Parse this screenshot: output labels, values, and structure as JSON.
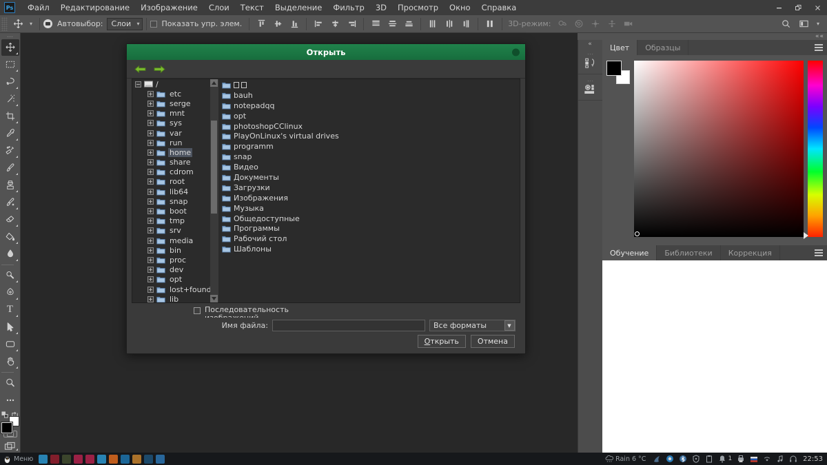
{
  "app": {
    "logo": "Ps",
    "menus": [
      "Файл",
      "Редактирование",
      "Изображение",
      "Слои",
      "Текст",
      "Выделение",
      "Фильтр",
      "3D",
      "Просмотр",
      "Окно",
      "Справка"
    ],
    "window_controls": [
      {
        "name": "minimize-button",
        "glyph": "—"
      },
      {
        "name": "restore-button",
        "glyph": "❐"
      },
      {
        "name": "close-button",
        "glyph": "✕"
      }
    ]
  },
  "options_bar": {
    "tool_icon": "move-tool-icon",
    "autoselect_label": "Автовыбор:",
    "autoselect_value": "Слои",
    "show_controls_label": "Показать упр. элем.",
    "mode3d_label": "3D-режим:",
    "align_icons": [
      "align-top-edges-icon",
      "align-vertical-centers-icon",
      "align-bottom-edges-icon",
      "align-left-edges-icon",
      "align-horizontal-centers-icon",
      "align-right-edges-icon"
    ],
    "distribute_icons": [
      "distribute-top-edges-icon",
      "distribute-vertical-centers-icon",
      "distribute-bottom-edges-icon",
      "distribute-left-edges-icon",
      "distribute-horizontal-centers-icon",
      "distribute-right-edges-icon"
    ],
    "distribute_spacing_icon": "distribute-spacing-icon",
    "mode3d_icons": [
      "orbit-3d-icon",
      "roll-3d-icon",
      "pan-3d-icon",
      "slide-3d-icon",
      "camera-3d-icon"
    ],
    "right_icons": [
      "search-icon",
      "workspace-icon",
      "chevron-down-icon"
    ]
  },
  "toolbar": {
    "tools": [
      {
        "name": "move-tool",
        "icon": "move-icon",
        "active": true,
        "more": true
      },
      {
        "name": "marquee-tool",
        "icon": "rectangular-marquee-icon",
        "more": true
      },
      {
        "name": "lasso-tool",
        "icon": "lasso-icon",
        "more": true
      },
      {
        "name": "magic-wand-tool",
        "icon": "magic-wand-icon",
        "more": true
      },
      {
        "name": "crop-tool",
        "icon": "crop-icon",
        "more": true
      },
      {
        "name": "eyedropper-tool",
        "icon": "eyedropper-icon",
        "more": true
      },
      {
        "name": "healing-brush-tool",
        "icon": "healing-brush-icon",
        "more": true
      },
      {
        "name": "brush-tool",
        "icon": "brush-icon",
        "more": true
      },
      {
        "name": "clone-stamp-tool",
        "icon": "clone-stamp-icon",
        "more": true
      },
      {
        "name": "history-brush-tool",
        "icon": "history-brush-icon",
        "more": true
      },
      {
        "name": "eraser-tool",
        "icon": "eraser-icon",
        "more": true
      },
      {
        "name": "gradient-tool",
        "icon": "paint-bucket-icon",
        "more": true
      },
      {
        "name": "blur-tool",
        "icon": "blur-drop-icon",
        "more": true
      },
      {
        "name": "dodge-tool",
        "icon": "dodge-icon",
        "more": true
      },
      {
        "name": "pen-tool",
        "icon": "pen-icon",
        "more": true
      },
      {
        "name": "type-tool",
        "icon": "type-icon",
        "more": true
      },
      {
        "name": "path-selection-tool",
        "icon": "path-arrow-icon",
        "more": true
      },
      {
        "name": "shape-tool",
        "icon": "rounded-rectangle-icon",
        "more": true
      },
      {
        "name": "hand-tool",
        "icon": "hand-icon",
        "more": true
      },
      {
        "name": "zoom-tool",
        "icon": "magnifier-icon",
        "more": false
      },
      {
        "name": "edit-toolbar",
        "icon": "ellipsis-icon",
        "more": false
      }
    ],
    "swap_colors_icon": "swap-colors-icon",
    "default_colors_icon": "default-colors-icon",
    "foreground_color": "#000000",
    "background_color": "#ffffff",
    "quick_mask_icon": "quick-mask-icon",
    "screen_mode_icon": "screen-mode-icon"
  },
  "dock_rail": {
    "buttons": [
      "history-panel-icon",
      "properties-panel-icon"
    ],
    "collapse_glyph": "«"
  },
  "color_panel": {
    "tabs": [
      {
        "label": "Цвет",
        "active": true
      },
      {
        "label": "Образцы",
        "active": false
      }
    ],
    "menu_icon": "panel-menu-icon",
    "foreground": "#000000",
    "background": "#ffffff",
    "hue_base": "#ff0000"
  },
  "learn_panel": {
    "tabs": [
      {
        "label": "Обучение",
        "active": true
      },
      {
        "label": "Библиотеки",
        "active": false
      },
      {
        "label": "Коррекция",
        "active": false
      }
    ],
    "menu_icon": "panel-menu-icon"
  },
  "dialog": {
    "title": "Открыть",
    "close_icon": "close-dot-icon",
    "back_icon": "back-arrow-icon",
    "forward_icon": "forward-arrow-icon",
    "tree_root": "/",
    "tree_items": [
      {
        "label": "etc"
      },
      {
        "label": "serge"
      },
      {
        "label": "mnt"
      },
      {
        "label": "sys"
      },
      {
        "label": "var"
      },
      {
        "label": "run"
      },
      {
        "label": "home",
        "selected": true
      },
      {
        "label": "share"
      },
      {
        "label": "cdrom"
      },
      {
        "label": "root"
      },
      {
        "label": "lib64"
      },
      {
        "label": "snap"
      },
      {
        "label": "boot"
      },
      {
        "label": "tmp"
      },
      {
        "label": "srv"
      },
      {
        "label": "media"
      },
      {
        "label": "bin"
      },
      {
        "label": "proc"
      },
      {
        "label": "dev"
      },
      {
        "label": "opt"
      },
      {
        "label": "lost+found"
      },
      {
        "label": "lib"
      }
    ],
    "expander_collapsed": "+",
    "expander_expanded": "−",
    "file_items": [
      {
        "label": "",
        "tofu": 2
      },
      {
        "label": "bauh"
      },
      {
        "label": "notepadqq"
      },
      {
        "label": "opt"
      },
      {
        "label": "photoshopCClinux"
      },
      {
        "label": "PlayOnLinux's virtual drives"
      },
      {
        "label": "programm"
      },
      {
        "label": "snap"
      },
      {
        "label": "Видео"
      },
      {
        "label": "Документы"
      },
      {
        "label": "Загрузки"
      },
      {
        "label": "Изображения"
      },
      {
        "label": "Музыка"
      },
      {
        "label": "Общедоступные"
      },
      {
        "label": "Программы"
      },
      {
        "label": "Рабочий стол"
      },
      {
        "label": "Шаблоны"
      }
    ],
    "sequence_checkbox_label": "Последовательность изображений",
    "filename_label": "Имя файла:",
    "filename_value": "",
    "format_value": "Все форматы",
    "open_button": "Открыть",
    "open_button_accel": "О",
    "cancel_button": "Отмена",
    "scrollbar_up": "▲",
    "scrollbar_down": "▼"
  },
  "taskbar": {
    "menu_label": "Меню",
    "menu_icon": "linux-penguin-icon",
    "apps": [
      {
        "name": "file-manager-icon",
        "color": "#2a8fc4"
      },
      {
        "name": "terminal-icon",
        "color": "#8d1f2d"
      },
      {
        "name": "text-editor-icon",
        "color": "#3f4a2f"
      },
      {
        "name": "screenshot-icon",
        "color": "#a8224a"
      },
      {
        "name": "screenshot-alt-icon",
        "color": "#a8224a"
      },
      {
        "name": "folder-icon",
        "color": "#2a8fc4"
      },
      {
        "name": "firefox-icon",
        "color": "#d2651e"
      },
      {
        "name": "browser-icon",
        "color": "#1d6fa5"
      },
      {
        "name": "notes-icon",
        "color": "#bb7c2c"
      },
      {
        "name": "krita-icon",
        "color": "#1d4f73"
      },
      {
        "name": "grid-app-icon",
        "color": "#2a6fa8"
      }
    ],
    "weather": "Rain 6 °C",
    "weather_icon": "cloud-rain-icon",
    "tray": [
      {
        "name": "krita-tray-icon"
      },
      {
        "name": "browser-tray-icon"
      },
      {
        "name": "bluetooth-icon"
      },
      {
        "name": "shield-icon"
      },
      {
        "name": "clipboard-icon"
      },
      {
        "name": "notification-icon",
        "badge": "1"
      },
      {
        "name": "printer-icon"
      },
      {
        "name": "keyboard-layout-icon"
      },
      {
        "name": "wifi-icon"
      },
      {
        "name": "music-icon"
      },
      {
        "name": "headphones-icon"
      }
    ],
    "clock": "22:53"
  }
}
